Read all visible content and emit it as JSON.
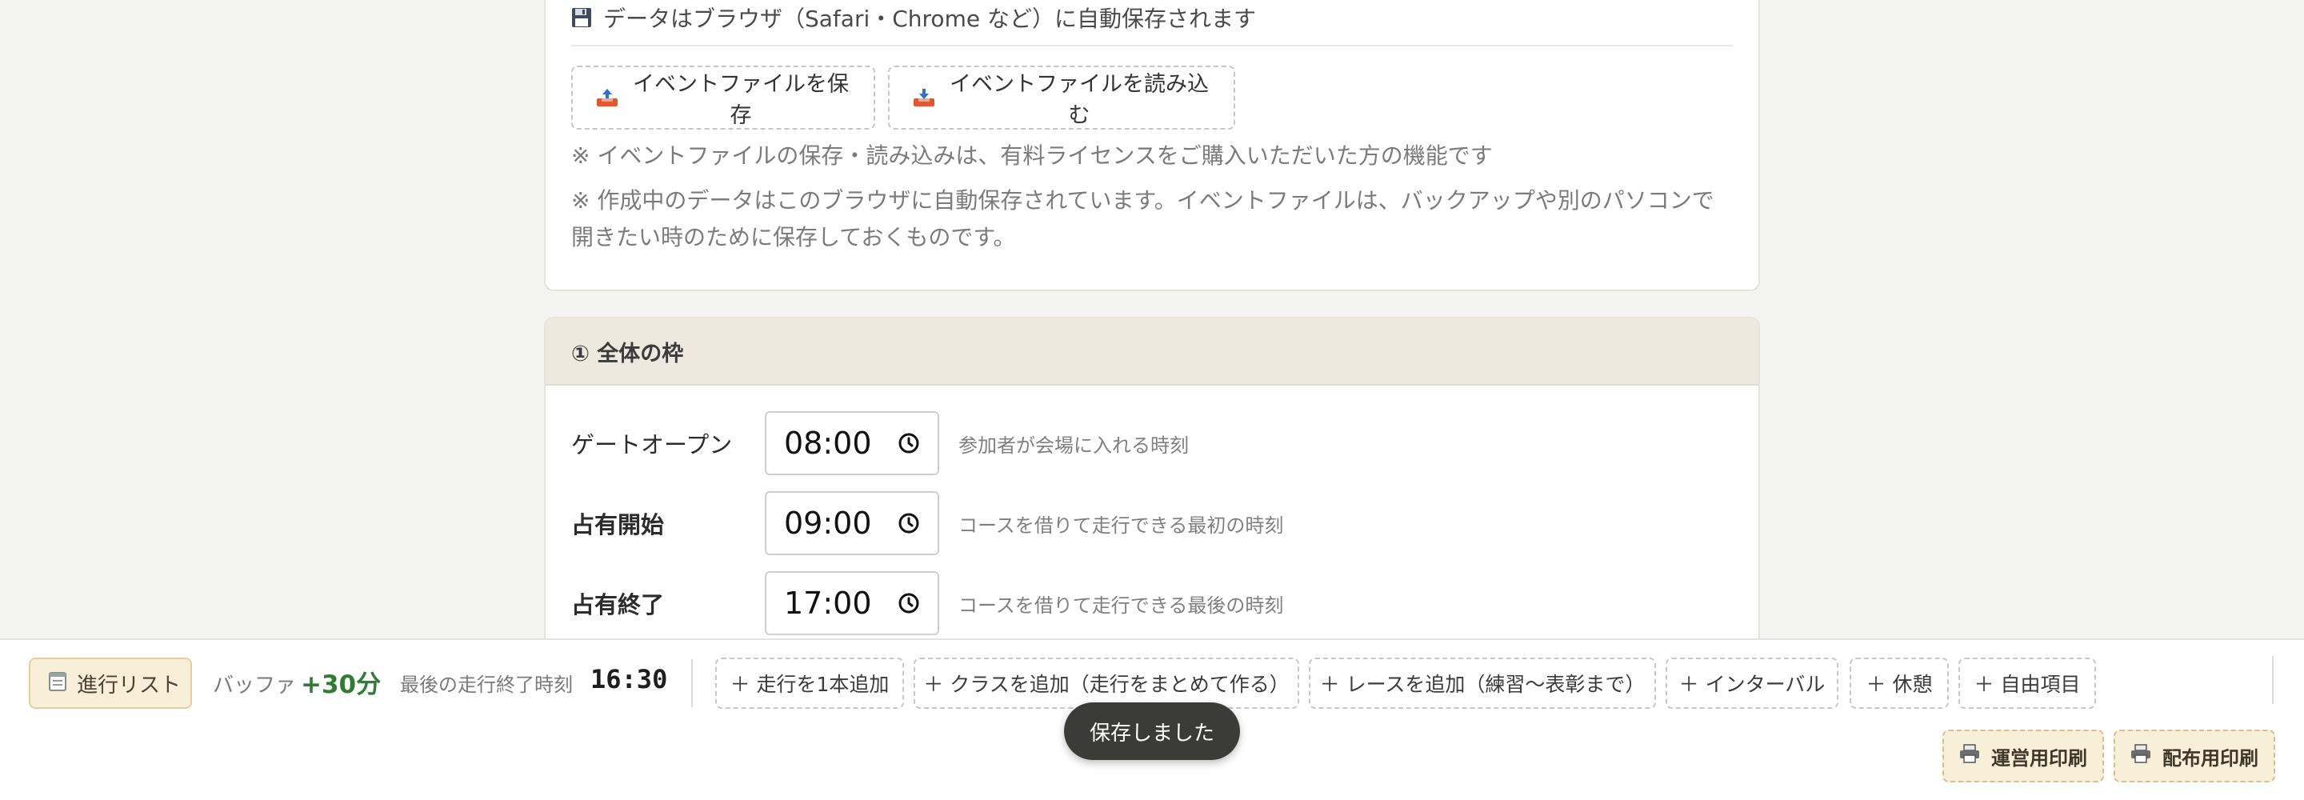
{
  "autosave": {
    "icon": "floppy-disk-icon",
    "text": "データはブラウザ（Safari・Chrome など）に自動保存されます"
  },
  "file_buttons": {
    "save_label": "イベントファイルを保存",
    "load_label": "イベントファイルを読み込む"
  },
  "notes": {
    "license": "※ イベントファイルの保存・読み込みは、有料ライセンスをご購入いただいた方の機能です",
    "backup": "※ 作成中のデータはこのブラウザに自動保存されています。イベントファイルは、バックアップや別のパソコンで開きたい時のために保存しておくものです。"
  },
  "frame": {
    "title": "① 全体の枠",
    "rows": [
      {
        "label": "ゲートオープン",
        "time": "08:00",
        "hint": "参加者が会場に入れる時刻"
      },
      {
        "label": "占有開始",
        "time": "09:00",
        "hint": "コースを借りて走行できる最初の時刻"
      },
      {
        "label": "占有終了",
        "time": "17:00",
        "hint": "コースを借りて走行できる最後の時刻"
      }
    ]
  },
  "toolbar": {
    "progress_list": "進行リスト",
    "buffer_label": "バッファ",
    "buffer_value": "+30分",
    "last_run_label": "最後の走行終了時刻",
    "last_run_value": "16:30",
    "add_run": "＋ 走行を1本追加",
    "add_class": "＋ クラスを追加（走行をまとめて作る）",
    "add_race": "＋ レースを追加（練習〜表彰まで）",
    "add_interval": "＋ インターバル",
    "add_break": "＋ 休憩",
    "add_free": "＋ 自由項目",
    "print_ops": "運営用印刷",
    "print_dist": "配布用印刷"
  },
  "toast": "保存しました",
  "colors": {
    "accent_cream": "#f8efd9",
    "buffer_green": "#2e7d32",
    "toast_bg": "#3b3b38"
  }
}
